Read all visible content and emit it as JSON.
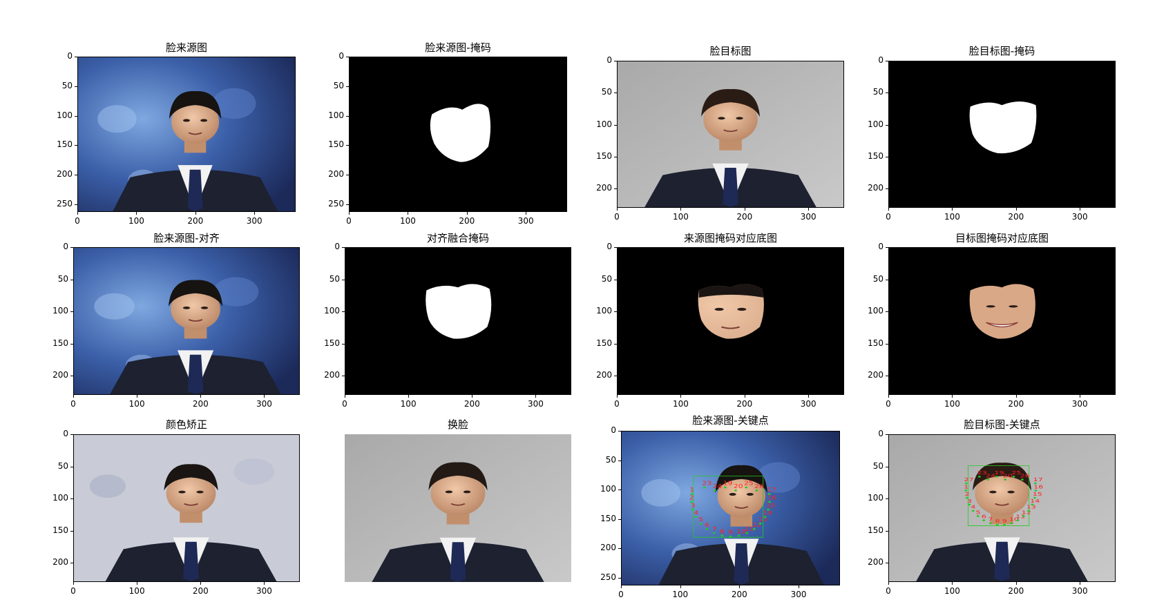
{
  "charts": [
    {
      "title": "脸来源图",
      "image": "source-face",
      "axes": true,
      "ylim": 263,
      "xlim": 370,
      "yticks": [
        "0",
        "50",
        "100",
        "150",
        "200",
        "250"
      ],
      "xticks": [
        "0",
        "100",
        "200",
        "300"
      ]
    },
    {
      "title": "脸来源图-掩码",
      "image": "source-mask",
      "axes": true,
      "ylim": 263,
      "xlim": 370,
      "yticks": [
        "0",
        "50",
        "100",
        "150",
        "200",
        "250"
      ],
      "xticks": [
        "0",
        "100",
        "200",
        "300"
      ]
    },
    {
      "title": "脸目标图",
      "image": "target-face",
      "axes": true,
      "ylim": 230,
      "xlim": 356,
      "yticks": [
        "0",
        "50",
        "100",
        "150",
        "200"
      ],
      "xticks": [
        "0",
        "100",
        "200",
        "300"
      ]
    },
    {
      "title": "脸目标图-掩码",
      "image": "target-mask",
      "axes": true,
      "ylim": 230,
      "xlim": 356,
      "yticks": [
        "0",
        "50",
        "100",
        "150",
        "200"
      ],
      "xticks": [
        "0",
        "100",
        "200",
        "300"
      ]
    },
    {
      "title": "脸来源图-对齐",
      "image": "source-aligned",
      "axes": true,
      "ylim": 230,
      "xlim": 356,
      "yticks": [
        "0",
        "50",
        "100",
        "150",
        "200"
      ],
      "xticks": [
        "0",
        "100",
        "200",
        "300"
      ]
    },
    {
      "title": "对齐融合掩码",
      "image": "combined-mask",
      "axes": true,
      "ylim": 230,
      "xlim": 356,
      "yticks": [
        "0",
        "50",
        "100",
        "150",
        "200"
      ],
      "xticks": [
        "0",
        "100",
        "200",
        "300"
      ]
    },
    {
      "title": "来源图掩码对应底图",
      "image": "source-masked",
      "axes": true,
      "ylim": 230,
      "xlim": 356,
      "yticks": [
        "0",
        "50",
        "100",
        "150",
        "200"
      ],
      "xticks": [
        "0",
        "100",
        "200",
        "300"
      ]
    },
    {
      "title": "目标图掩码对应底图",
      "image": "target-masked",
      "axes": true,
      "ylim": 230,
      "xlim": 356,
      "yticks": [
        "0",
        "50",
        "100",
        "150",
        "200"
      ],
      "xticks": [
        "0",
        "100",
        "200",
        "300"
      ]
    },
    {
      "title": "颜色矫正",
      "image": "color-corrected",
      "axes": true,
      "ylim": 230,
      "xlim": 356,
      "yticks": [
        "0",
        "50",
        "100",
        "150",
        "200"
      ],
      "xticks": [
        "0",
        "100",
        "200",
        "300"
      ]
    },
    {
      "title": "换脸",
      "image": "swapped-face",
      "axes": false
    },
    {
      "title": "脸来源图-关键点",
      "image": "source-landmarks",
      "axes": true,
      "ylim": 263,
      "xlim": 370,
      "yticks": [
        "0",
        "50",
        "100",
        "150",
        "200",
        "250"
      ],
      "xticks": [
        "0",
        "100",
        "200",
        "300"
      ]
    },
    {
      "title": "脸目标图-关键点",
      "image": "target-landmarks",
      "axes": true,
      "ylim": 230,
      "xlim": 356,
      "yticks": [
        "0",
        "50",
        "100",
        "150",
        "200"
      ],
      "xticks": [
        "0",
        "100",
        "200",
        "300"
      ]
    }
  ],
  "landmark_labels": {
    "source": [
      "23",
      "24",
      "19",
      "20",
      "25",
      "26",
      "1",
      "2",
      "3",
      "4",
      "5",
      "6",
      "7",
      "8",
      "9",
      "10",
      "11",
      "12",
      "13",
      "14",
      "15",
      "16",
      "17"
    ],
    "target": [
      "23",
      "24",
      "19",
      "20",
      "25",
      "26",
      "27",
      "1",
      "2",
      "3",
      "4",
      "5",
      "6",
      "7",
      "8",
      "9",
      "10",
      "11",
      "12",
      "13",
      "14",
      "15",
      "16",
      "17"
    ]
  },
  "colors": {
    "landmark_box": "#22cc22",
    "landmark_text": "#ff2020",
    "landmark_dot": "#22cc22",
    "mask": "#ffffff",
    "background": "#000000"
  }
}
